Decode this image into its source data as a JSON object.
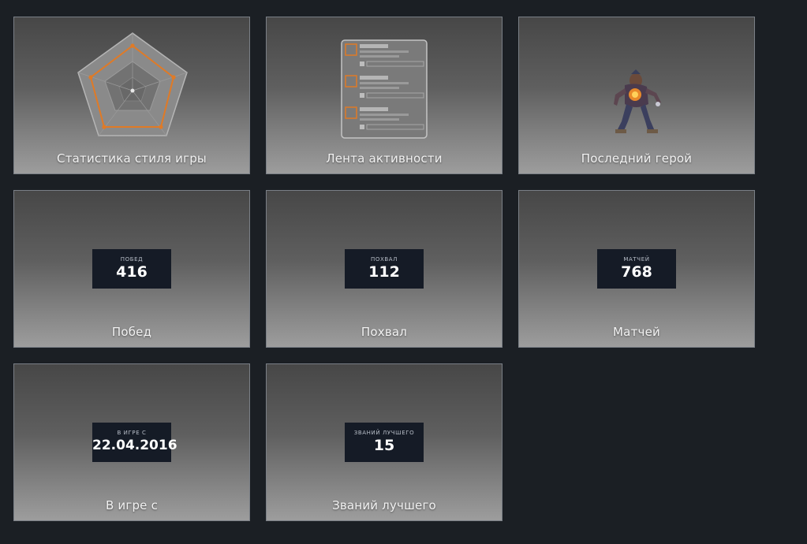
{
  "tiles": {
    "playstyle": {
      "label": "Статистика стиля игры"
    },
    "activity": {
      "label": "Лента активности"
    },
    "last_hero": {
      "label": "Последний герой"
    },
    "wins": {
      "label": "Побед",
      "caption": "ПОБЕД",
      "value": "416"
    },
    "commends": {
      "label": "Похвал",
      "caption": "ПОХВАЛ",
      "value": "112"
    },
    "matches": {
      "label": "Матчей",
      "caption": "МАТЧЕЙ",
      "value": "768"
    },
    "since": {
      "label": "В игре с",
      "caption": "В ИГРЕ С",
      "value": "22.04.2016"
    },
    "best_ranks": {
      "label": "Званий лучшего",
      "caption": "ЗВАНИЙ ЛУЧШЕГО",
      "value": "15"
    }
  },
  "colors": {
    "accent": "#e07a26",
    "page_background": "#1b1f24",
    "stat_box": "#151b26"
  },
  "icons": {
    "playstyle": "radar-chart-icon",
    "activity": "activity-feed-icon",
    "last_hero": "hero-portrait-icon"
  }
}
